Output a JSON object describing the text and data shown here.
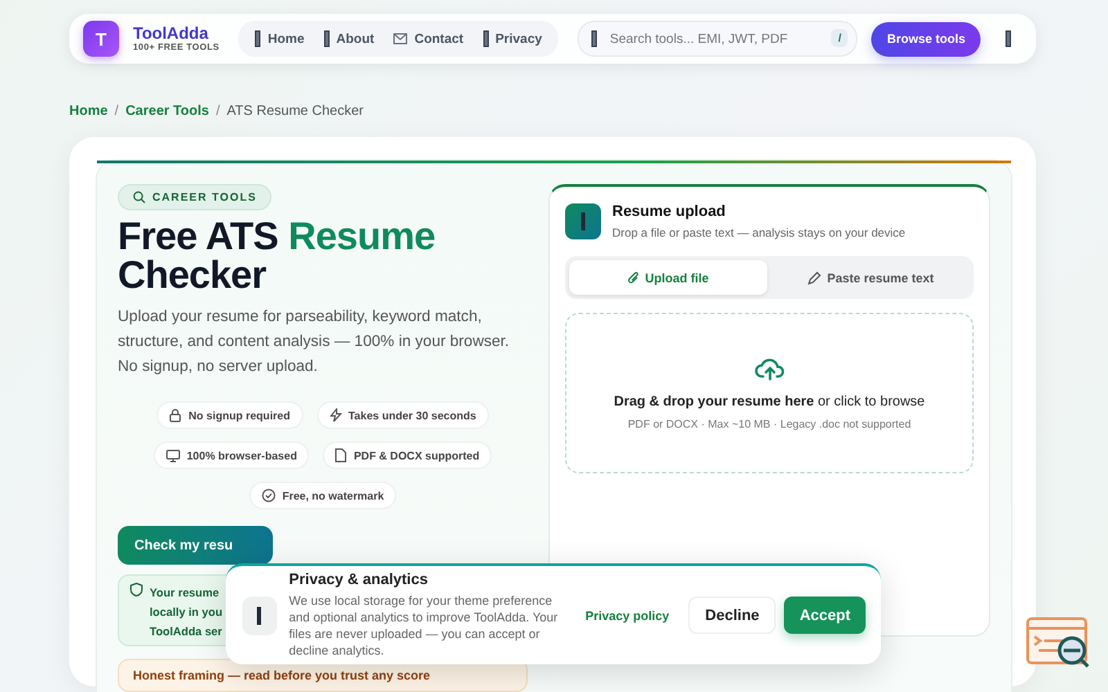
{
  "header": {
    "logo_letter": "T",
    "brand": "ToolAdda",
    "tagline": "100+ FREE TOOLS",
    "nav": [
      "Home",
      "About",
      "Contact",
      "Privacy"
    ],
    "search": {
      "placeholder": "Search tools... EMI, JWT, PDF",
      "shortcut": "/"
    },
    "browse_button": "Browse tools"
  },
  "breadcrumb": [
    {
      "label": "Home",
      "link": true
    },
    {
      "label": "Career Tools",
      "link": true
    },
    {
      "label": "ATS Resume Checker",
      "link": false
    }
  ],
  "breadcrumb_separator": "/",
  "hero": {
    "badge": "CAREER TOOLS",
    "title_parts": [
      {
        "text": "Free ATS",
        "accent": false
      },
      {
        "text": "Resume",
        "accent": true
      },
      {
        "text": "Checker",
        "accent": false
      }
    ],
    "description": "Upload your resume for parseability, keyword match, structure, and content analysis — 100% in your browser. No signup, no server upload.",
    "features": [
      "No signup required",
      "Takes under 30 seconds",
      "100% browser-based",
      "PDF & DOCX supported",
      "Free, no watermark"
    ],
    "primary_button": "Check my resu",
    "privacy_note": [
      "Your resume",
      "locally in you",
      "ToolAdda ser"
    ],
    "honest_note": "Honest framing — read before you trust any score"
  },
  "upload": {
    "title": "Resume upload",
    "subtitle": "Drop a file or paste text — analysis stays on your device",
    "tabs": [
      {
        "label": "Upload file",
        "selected": true
      },
      {
        "label": "Paste resume text",
        "selected": false
      }
    ],
    "drop_text": "**Drag & drop your resume here** or click to browse",
    "drop_hint": "PDF or DOCX · Max ~10 MB · Legacy .doc not supported"
  },
  "consent": {
    "title": "Privacy & analytics",
    "text": "We use local storage for your theme preference and optional analytics to improve ToolAdda. Your files are never uploaded — you can accept or decline analytics.",
    "link": "Privacy policy",
    "buttons": [
      {
        "label": "Decline",
        "kind": "secondary"
      },
      {
        "label": "Accept",
        "kind": "primary"
      }
    ]
  }
}
